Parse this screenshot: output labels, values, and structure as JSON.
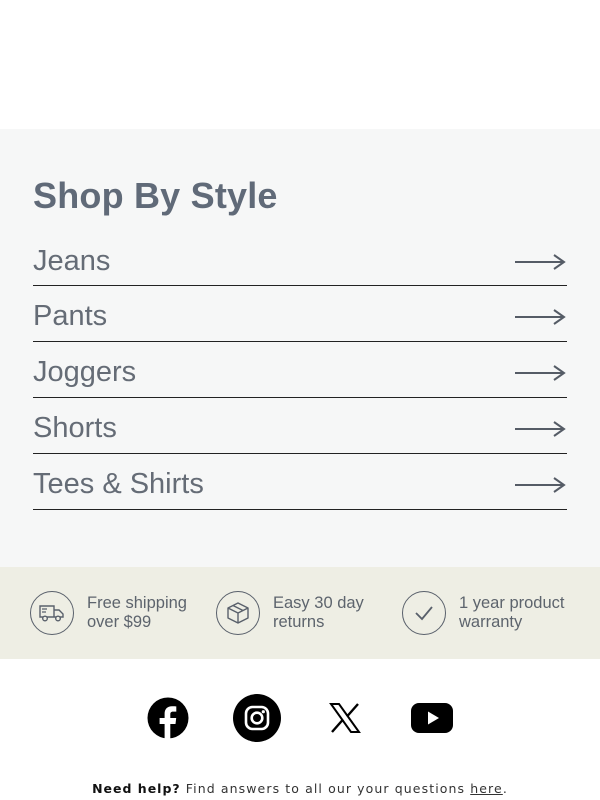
{
  "style_section": {
    "title": "Shop By Style",
    "items": [
      {
        "label": "Jeans"
      },
      {
        "label": "Pants"
      },
      {
        "label": "Joggers"
      },
      {
        "label": "Shorts"
      },
      {
        "label": "Tees & Shirts"
      }
    ]
  },
  "perks": [
    {
      "icon": "delivery-truck-icon",
      "line1": "Free shipping",
      "line2": "over $99"
    },
    {
      "icon": "package-box-icon",
      "line1": "Easy 30 day",
      "line2": "returns"
    },
    {
      "icon": "checkmark-icon",
      "line1": "1 year product",
      "line2": "warranty"
    }
  ],
  "social": [
    "facebook-icon",
    "instagram-icon",
    "x-icon",
    "youtube-icon"
  ],
  "footer": {
    "need_help": "Need help?",
    "text": "Find answers to all our your questions",
    "link": "here",
    "end": "."
  },
  "colors": {
    "section_bg": "#f6f7f7",
    "perks_bg": "#eeeee4",
    "title": "#606a78",
    "label": "#656c76"
  }
}
